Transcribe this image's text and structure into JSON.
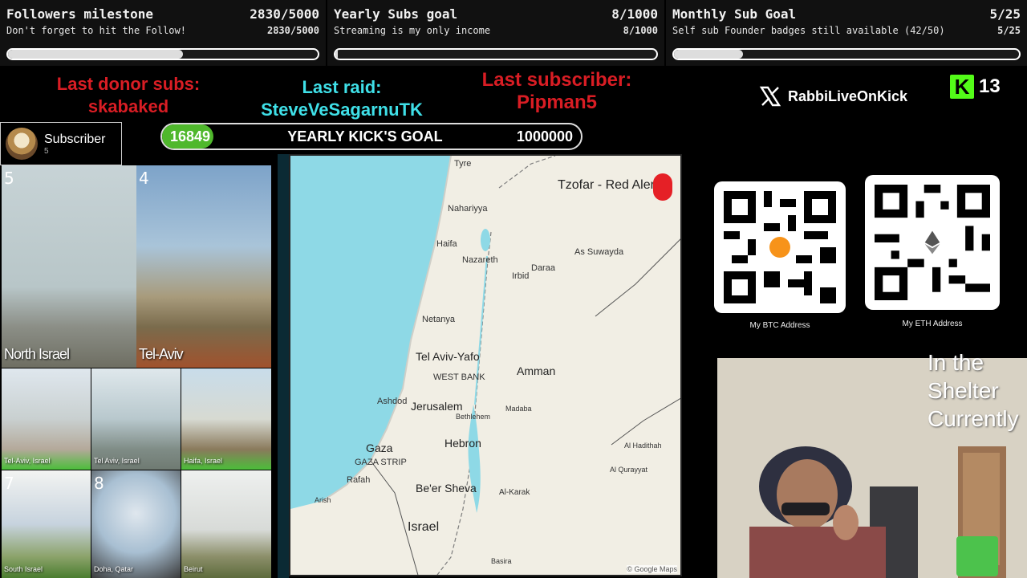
{
  "goals": [
    {
      "title": "Followers milestone",
      "count": "2830/5000",
      "subtitle": "Don't forget to hit the Follow!",
      "progress": 0.566
    },
    {
      "title": "Yearly Subs goal",
      "count": "8/1000",
      "subtitle": "Streaming is my only income",
      "progress": 0.008
    },
    {
      "title": "Monthly Sub Goal",
      "count": "5/25",
      "subtitle": "Self sub Founder badges still available (42/50)",
      "progress": 0.2
    }
  ],
  "last_donor": {
    "label": "Last donor subs:",
    "name": "skabaked"
  },
  "last_raid": {
    "label": "Last raid:",
    "name": "SteveVeSagarnuTK"
  },
  "last_sub": {
    "label": "Last subscriber:",
    "name": "Pipman5"
  },
  "subscriber_card": {
    "title": "Subscriber",
    "count": "5"
  },
  "kick_goal": {
    "current": "16849",
    "title": "YEARLY KICK'S GOAL",
    "target": "1000000",
    "progress": 0.016849
  },
  "cameras": [
    {
      "num": "5",
      "label": "North Israel"
    },
    {
      "num": "4",
      "label": "Tel-Aviv"
    },
    {
      "num": "",
      "label": "Tel-Aviv, Israel"
    },
    {
      "num": "",
      "label": "Tel Aviv, Israel"
    },
    {
      "num": "",
      "label": "Haifa, Israel"
    },
    {
      "num": "7",
      "label": "South Israel"
    },
    {
      "num": "8",
      "label": "Doha, Qatar"
    },
    {
      "num": "",
      "label": "Beirut"
    }
  ],
  "map": {
    "title": "Tzofar - Red Alert",
    "credit": "© Google Maps",
    "places": {
      "tyre": "Tyre",
      "nahariyya": "Nahariyya",
      "haifa": "Haifa",
      "nazareth": "Nazareth",
      "irbid": "Irbid",
      "daraa": "Daraa",
      "suwayda": "As Suwayda",
      "netanya": "Netanya",
      "telaviv": "Tel Aviv-Yafo",
      "westbank": "WEST BANK",
      "amman": "Amman",
      "ashdod": "Ashdod",
      "jerusalem": "Jerusalem",
      "bethlehem": "Bethlehem",
      "madaba": "Madaba",
      "gaza": "Gaza",
      "gazastrip": "GAZA STRIP",
      "hebron": "Hebron",
      "rafah": "Rafah",
      "beersheva": "Be'er Sheva",
      "arish": "Arish",
      "alkarak": "Al-Karak",
      "israel": "Israel",
      "haditha": "Al Hadithah",
      "qurayyat": "Al Qurayyat",
      "basira": "Basira"
    }
  },
  "social": {
    "handle": "RabbiLiveOnKick",
    "kick_count": "13"
  },
  "crypto": {
    "btc_label": "My BTC Address",
    "eth_label": "My ETH Address"
  },
  "shelter_text": [
    "In the",
    "Shelter",
    "Currently"
  ],
  "colors": {
    "kick_green": "#53fc18",
    "alert_red": "#d91d24",
    "raid_cyan": "#3fe0e8",
    "goal_fill_green": "#4fb82c"
  }
}
